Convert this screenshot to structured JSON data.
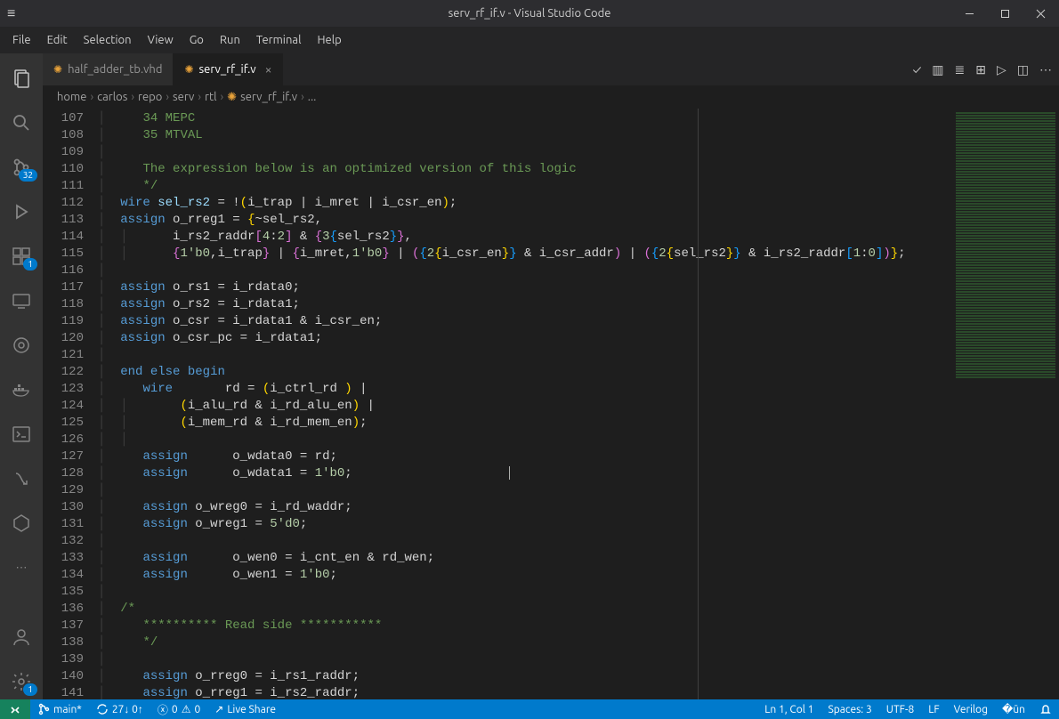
{
  "window": {
    "title": "serv_rf_if.v - Visual Studio Code"
  },
  "menu": [
    "File",
    "Edit",
    "Selection",
    "View",
    "Go",
    "Run",
    "Terminal",
    "Help"
  ],
  "activity": {
    "scm_badge": "32",
    "ext_badge": "1",
    "settings_badge": "1"
  },
  "tabs": [
    {
      "label": "half_adder_tb.vhd",
      "active": false
    },
    {
      "label": "serv_rf_if.v",
      "active": true
    }
  ],
  "breadcrumb": [
    "home",
    "carlos",
    "repo",
    "serv",
    "rtl",
    "serv_rf_if.v",
    "..."
  ],
  "line_start": 107,
  "line_end": 141,
  "code": {
    "107": {
      "cm": "34 MEPC"
    },
    "108": {
      "cm": "35 MTVAL"
    },
    "110": {
      "cm": "The expression below is an optimized version of this logic"
    },
    "111": {
      "cm": "*/"
    },
    "l112": "wire sel_rs2 = !(i_trap | i_mret | i_csr_en);",
    "l113": "assign o_rreg1 = {~sel_rs2,",
    "l114": "i_rs2_raddr[4:2] & {3{sel_rs2}},",
    "l115": "{1'b0,i_trap} | {i_mret,1'b0} | ({2{i_csr_en}} & i_csr_addr) | ({2{sel_rs2}} & i_rs2_raddr[1:0])};",
    "l117": "assign o_rs1 = i_rdata0;",
    "l118": "assign o_rs2 = i_rdata1;",
    "l119": "assign o_csr = i_rdata1 & i_csr_en;",
    "l120": "assign o_csr_pc = i_rdata1;",
    "l122": "end else begin",
    "l123": "wire       rd = (i_ctrl_rd ) |",
    "l124": "(i_alu_rd & i_rd_alu_en) |",
    "l125": "(i_mem_rd & i_rd_mem_en);",
    "l127": "assign      o_wdata0 = rd;",
    "l128": "assign      o_wdata1 = 1'b0;",
    "l130": "assign o_wreg0 = i_rd_waddr;",
    "l131": "assign o_wreg1 = 5'd0;",
    "l133": "assign      o_wen0 = i_cnt_en & rd_wen;",
    "l134": "assign      o_wen1 = 1'b0;",
    "l136": "/*",
    "l137": "********** Read side ***********",
    "l138": "*/",
    "l140": "assign o_rreg0 = i_rs1_raddr;",
    "l141": "assign o_rreg1 = i_rs2_raddr;"
  },
  "statusbar": {
    "branch": "main*",
    "sync": "27↓ 0↑",
    "errors": "0",
    "warnings": "0",
    "liveshare": "Live Share",
    "lncol": "Ln 1, Col 1",
    "spaces": "Spaces: 3",
    "encoding": "UTF-8",
    "eol": "LF",
    "lang": "Verilog"
  }
}
